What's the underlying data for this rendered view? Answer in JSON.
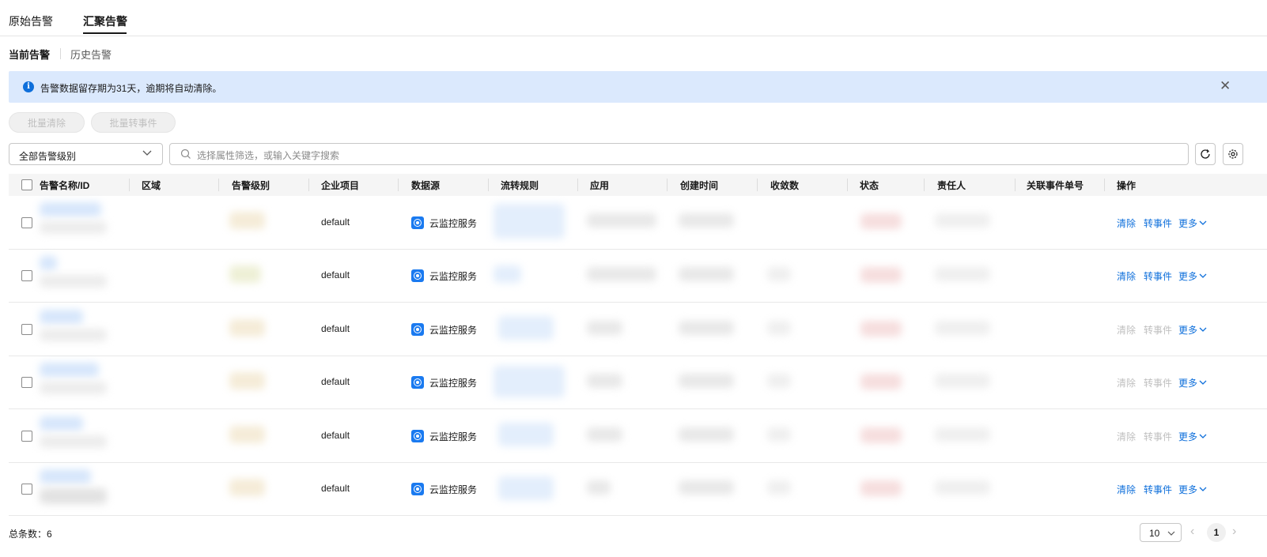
{
  "top_tabs": [
    {
      "label": "原始告警",
      "active": false
    },
    {
      "label": "汇聚告警",
      "active": true
    }
  ],
  "sub_tabs": [
    {
      "label": "当前告警",
      "active": true
    },
    {
      "label": "历史告警",
      "active": false
    }
  ],
  "banner": {
    "icon": "info-icon",
    "text": "告警数据留存期为31天，逾期将自动清除。",
    "close_icon": "close-icon",
    "color": "#dbe9fd"
  },
  "batch_actions": {
    "clear": "批量清除",
    "to_event": "批量转事件"
  },
  "filters": {
    "level_select": "全部告警级别",
    "search_placeholder": "选择属性筛选，或输入关键字搜索"
  },
  "toolbar_icons": [
    "refresh-icon",
    "settings-icon"
  ],
  "table": {
    "columns": [
      "告警名称/ID",
      "区域",
      "告警级别",
      "企业项目",
      "数据源",
      "流转规则",
      "应用",
      "创建时间",
      "收敛数",
      "状态",
      "责任人",
      "关联事件单号",
      "操作"
    ],
    "rows": [
      {
        "project": "default",
        "source": "云监控服务",
        "actions": {
          "clear": "清除",
          "to_event": "转事件",
          "more": "更多",
          "enabled": true
        }
      },
      {
        "project": "default",
        "source": "云监控服务",
        "actions": {
          "clear": "清除",
          "to_event": "转事件",
          "more": "更多",
          "enabled": true
        }
      },
      {
        "project": "default",
        "source": "云监控服务",
        "actions": {
          "clear": "清除",
          "to_event": "转事件",
          "more": "更多",
          "enabled": false
        }
      },
      {
        "project": "default",
        "source": "云监控服务",
        "actions": {
          "clear": "清除",
          "to_event": "转事件",
          "more": "更多",
          "enabled": false
        }
      },
      {
        "project": "default",
        "source": "云监控服务",
        "actions": {
          "clear": "清除",
          "to_event": "转事件",
          "more": "更多",
          "enabled": false
        }
      },
      {
        "project": "default",
        "source": "云监控服务",
        "actions": {
          "clear": "清除",
          "to_event": "转事件",
          "more": "更多",
          "enabled": true
        }
      }
    ]
  },
  "footer": {
    "total": "总条数：6",
    "page_size": "10",
    "current_page": "1"
  },
  "colors": {
    "link": "#0e6fdb",
    "disabled": "#bfbfbf",
    "header_bg": "#f5f5f5",
    "accent_icon": "#1a7af0"
  }
}
